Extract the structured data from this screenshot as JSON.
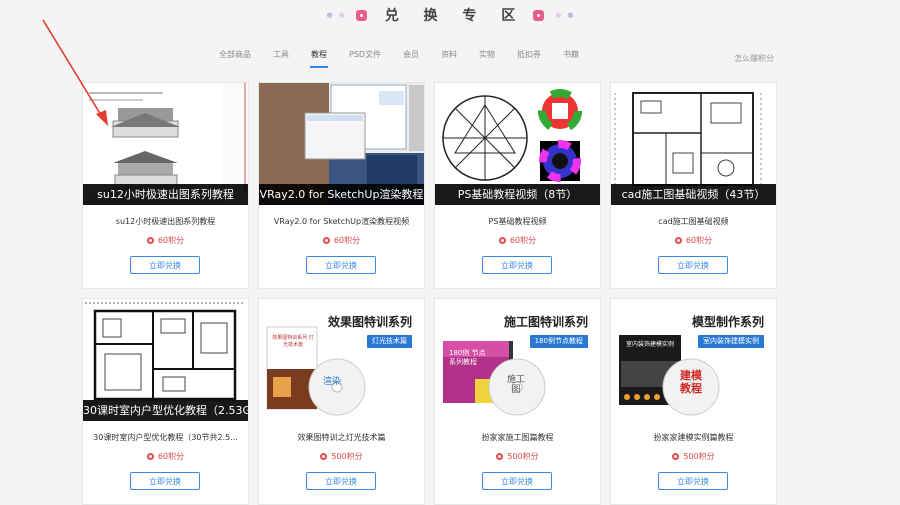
{
  "header": {
    "title": "兑 换 专 区"
  },
  "tabs": [
    {
      "label": "全部商品",
      "active": false
    },
    {
      "label": "工具",
      "active": false
    },
    {
      "label": "教程",
      "active": true
    },
    {
      "label": "PSD文件",
      "active": false
    },
    {
      "label": "会员",
      "active": false
    },
    {
      "label": "资料",
      "active": false
    },
    {
      "label": "实物",
      "active": false
    },
    {
      "label": "抵扣券",
      "active": false
    },
    {
      "label": "书籍",
      "active": false
    }
  ],
  "how_to_earn": "怎么赚积分",
  "redeem_label": "立即兑换",
  "accent_color": "#3b87e5",
  "points_color": "#e04a4a",
  "cards": [
    {
      "caption": "su12小时极速出图系列教程",
      "name": "su12小时极速出图系列教程",
      "points": "60积分"
    },
    {
      "caption": "VRay2.0 for SketchUp渲染教程",
      "name": "VRay2.0 for SketchUp渲染教程视频",
      "points": "60积分"
    },
    {
      "caption": "PS基础教程视频（8节）",
      "name": "PS基础教程视频",
      "points": "60积分"
    },
    {
      "caption": "cad施工图基础视频（43节）",
      "name": "cad施工图基础视频",
      "points": "60积分"
    },
    {
      "caption": "30课时室内户型优化教程（2.53G）",
      "name": "30课时室内户型优化教程（30节共2.5...",
      "points": "60积分"
    },
    {
      "promo_title": "效果图特训系列",
      "promo_tag": "灯光技术篇",
      "book_text": "效果图特训系列 灯光技术篇",
      "disc_text": "渲染",
      "name": "效果图特训之灯光技术篇",
      "points": "500积分"
    },
    {
      "promo_title": "施工图特训系列",
      "promo_tag": "180例节点教程",
      "book_text": "180例 节点系列教程",
      "disc_text": "施工图",
      "name": "扮家家施工图篇教程",
      "points": "500积分"
    },
    {
      "promo_title": "模型制作系列",
      "promo_tag": "室内装饰建模实例",
      "book_text": "室内装饰建模实例",
      "disc_text": "建模教程",
      "name": "扮家家建模实例篇教程",
      "points": "500积分"
    }
  ]
}
